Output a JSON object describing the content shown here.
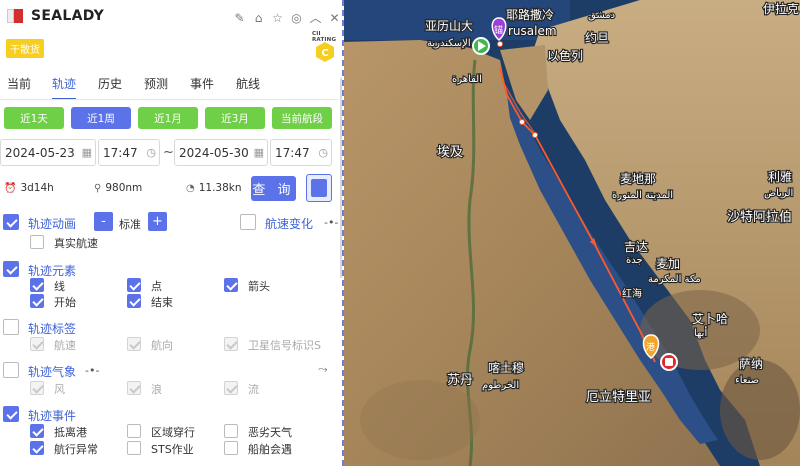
{
  "ship": {
    "name": "SEALADY",
    "type_tag": "干散货",
    "cii_label": "CII RATING",
    "cii_grade": "C",
    "header_icons": [
      "edit-icon",
      "tag-icon",
      "star-icon",
      "target-icon",
      "collapse-icon",
      "close-icon"
    ]
  },
  "tabs": [
    {
      "label": "当前",
      "active": false
    },
    {
      "label": "轨迹",
      "active": true
    },
    {
      "label": "历史",
      "active": false
    },
    {
      "label": "预测",
      "active": false
    },
    {
      "label": "事件",
      "active": false
    },
    {
      "label": "航线",
      "active": false
    }
  ],
  "ranges": [
    {
      "label": "近1天",
      "active": false
    },
    {
      "label": "近1周",
      "active": true
    },
    {
      "label": "近1月",
      "active": false
    },
    {
      "label": "近3月",
      "active": false
    },
    {
      "label": "当前航段",
      "active": false
    }
  ],
  "time_range": {
    "start_date": "2024-05-23",
    "start_time": "17:47",
    "separator": "~",
    "end_date": "2024-05-30",
    "end_time": "17:47"
  },
  "stats": {
    "duration": "3d14h",
    "distance": "980nm",
    "speed": "11.38kn"
  },
  "query_label": "查 询",
  "sections": {
    "animation": {
      "title": "轨迹动画",
      "checked": true,
      "minus": "-",
      "speed_label": "标准",
      "plus": "+",
      "real_speed": "真实航速",
      "real_speed_checked": false
    },
    "speed_change": {
      "title": "航速变化",
      "checked": false
    },
    "elements": {
      "title": "轨迹元素",
      "checked": true,
      "items": [
        {
          "label": "线",
          "checked": true
        },
        {
          "label": "点",
          "checked": true
        },
        {
          "label": "箭头",
          "checked": true
        },
        {
          "label": "开始",
          "checked": true
        },
        {
          "label": "结束",
          "checked": true
        }
      ]
    },
    "labels": {
      "title": "轨迹标签",
      "checked": false,
      "items": [
        {
          "label": "航速"
        },
        {
          "label": "航向"
        },
        {
          "label": "卫星信号标识S"
        }
      ]
    },
    "weather": {
      "title": "轨迹气象",
      "checked": false,
      "items": [
        {
          "label": "风"
        },
        {
          "label": "浪"
        },
        {
          "label": "流"
        }
      ]
    },
    "events": {
      "title": "轨迹事件",
      "checked": true,
      "items": [
        {
          "label": "抵离港",
          "checked": true
        },
        {
          "label": "区域穿行",
          "checked": false
        },
        {
          "label": "恶劣天气",
          "checked": false
        },
        {
          "label": "航行异常",
          "checked": true
        },
        {
          "label": "STS作业",
          "checked": false
        },
        {
          "label": "船舶会遇",
          "checked": false
        }
      ]
    }
  },
  "map": {
    "labels": {
      "alexandria": "亚历山大",
      "alexandria_ar": "الإسكندرية",
      "cairo_ar": "القاهرة",
      "jerusalem": "耶路撒冷",
      "jerusalem_en": "rusalem",
      "amman_ar": "دمشق",
      "amman": "伊拉克",
      "jordan": "约旦",
      "israel": "以色列",
      "egypt": "埃及",
      "medina": "麦地那",
      "medina_ar": "المدينة المنورة",
      "saudi": "沙特阿拉伯",
      "riyadh": "利雅",
      "riyadh_ar": "الرياض",
      "jeddah": "吉达",
      "jeddah_ar": "جدة",
      "mecca": "麦加",
      "mecca_ar": "مكة المكرمة",
      "red_sea": "红海",
      "abha": "艾卜哈",
      "abha_ar": "أبها",
      "khartoum": "喀土穆",
      "khartoum_ar": "الخرطوم",
      "sudan": "苏丹",
      "eritrea": "厄立特里亚",
      "sanaa": "萨纳",
      "sanaa_ar": "صنعاء"
    },
    "markers": {
      "anchor": "锚",
      "port": "港"
    }
  }
}
